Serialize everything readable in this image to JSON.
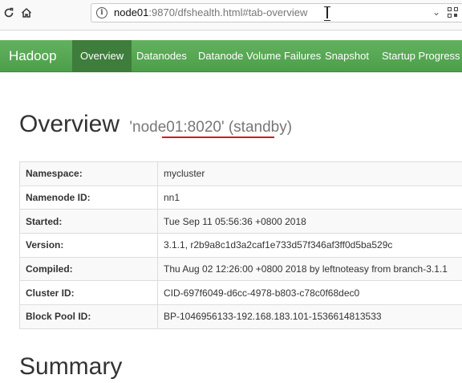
{
  "browser": {
    "url_host": "node01",
    "url_rest": ":9870/dfshealth.html#tab-overview",
    "icons": [
      "reload-icon",
      "home-icon",
      "info-icon",
      "dropdown-icon",
      "qr-code-icon"
    ]
  },
  "navbar": {
    "brand": "Hadoop",
    "items": [
      {
        "label": "Overview",
        "active": true
      },
      {
        "label": "Datanodes"
      },
      {
        "label": "Datanode Volume Failures"
      },
      {
        "label": "Snapshot"
      },
      {
        "label": "Startup Progress"
      }
    ],
    "color": "#5cb85c"
  },
  "overview": {
    "title": "Overview",
    "subtitle": "'node01:8020' (standby)",
    "rows": [
      {
        "key": "Namespace:",
        "value": "mycluster"
      },
      {
        "key": "Namenode ID:",
        "value": "nn1"
      },
      {
        "key": "Started:",
        "value": "Tue Sep 11 05:56:36 +0800 2018"
      },
      {
        "key": "Version:",
        "value": "3.1.1, r2b9a8c1d3a2caf1e733d57f346af3ff0d5ba529c"
      },
      {
        "key": "Compiled:",
        "value": "Thu Aug 02 12:26:00 +0800 2018 by leftnoteasy from branch-3.1.1"
      },
      {
        "key": "Cluster ID:",
        "value": "CID-697f6049-d6cc-4978-b803-c78c0f68dec0"
      },
      {
        "key": "Block Pool ID:",
        "value": "BP-1046956133-192.168.183.101-1536614813533"
      }
    ]
  },
  "summary": {
    "title": "Summary"
  },
  "annotation_color": "#d7191c"
}
